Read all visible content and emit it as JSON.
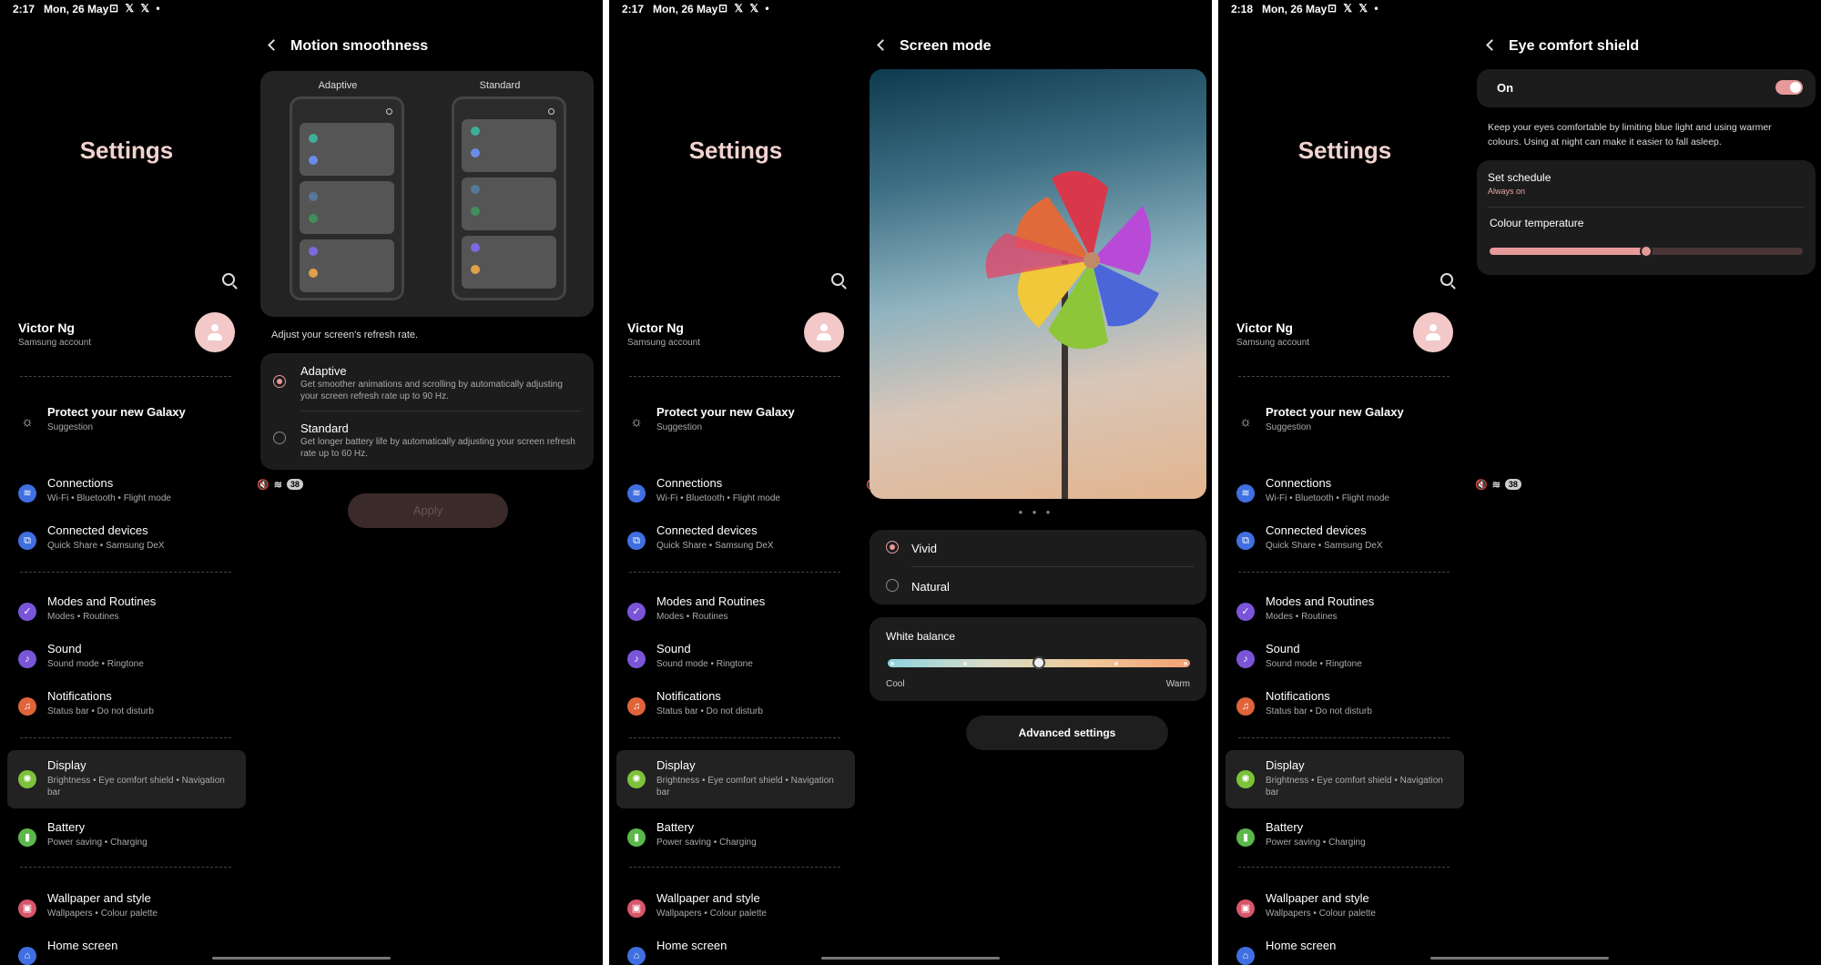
{
  "panels": [
    {
      "status": {
        "time": "2:17",
        "date": "Mon, 26 May",
        "battery": "38"
      },
      "header": "Motion smoothness",
      "preview_labels": [
        "Adaptive",
        "Standard"
      ],
      "refresh_note": "Adjust your screen's refresh rate.",
      "options": [
        {
          "title": "Adaptive",
          "desc": "Get smoother animations and scrolling by automatically adjusting your screen refresh rate up to 90 Hz.",
          "selected": true
        },
        {
          "title": "Standard",
          "desc": "Get longer battery life by automatically adjusting your screen refresh rate up to 60 Hz.",
          "selected": false
        }
      ],
      "apply_label": "Apply"
    },
    {
      "status": {
        "time": "2:17",
        "date": "Mon, 26 May",
        "battery": "38"
      },
      "header": "Screen mode",
      "modes": [
        {
          "label": "Vivid",
          "selected": true
        },
        {
          "label": "Natural",
          "selected": false
        }
      ],
      "white_balance": {
        "title": "White balance",
        "min_label": "Cool",
        "max_label": "Warm",
        "value_fraction": 0.5
      },
      "advanced_label": "Advanced settings"
    },
    {
      "status": {
        "time": "2:18",
        "date": "Mon, 26 May",
        "battery": "38"
      },
      "header": "Eye comfort shield",
      "toggle_label": "On",
      "toggle_on": true,
      "description": "Keep your eyes comfortable by limiting blue light and using warmer colours. Using at night can make it easier to fall asleep.",
      "schedule": {
        "title": "Set schedule",
        "value": "Always on"
      },
      "colour_temperature": {
        "title": "Colour temperature",
        "value_fraction": 0.5
      }
    }
  ],
  "settings": {
    "title": "Settings",
    "profile": {
      "name": "Victor Ng",
      "sub": "Samsung account"
    },
    "items": [
      {
        "title": "Protect your new Galaxy",
        "sub": "Suggestion",
        "icon": "lightbulb-icon",
        "color": "#000000"
      },
      {
        "title": "Connections",
        "sub": "Wi-Fi  •  Bluetooth  •  Flight mode",
        "icon": "wifi-icon",
        "color": "#3f6fe0"
      },
      {
        "title": "Connected devices",
        "sub": "Quick Share  •  Samsung DeX",
        "icon": "devices-icon",
        "color": "#3f6fe0"
      },
      {
        "title": "Modes and Routines",
        "sub": "Modes  •  Routines",
        "icon": "routines-icon",
        "color": "#7a55d8"
      },
      {
        "title": "Sound",
        "sub": "Sound mode  •  Ringtone",
        "icon": "sound-icon",
        "color": "#7a55d8"
      },
      {
        "title": "Notifications",
        "sub": "Status bar  •  Do not disturb",
        "icon": "bell-icon",
        "color": "#e0643a"
      },
      {
        "title": "Display",
        "sub": "Brightness  •  Eye comfort shield  •  Navigation bar",
        "icon": "sun-icon",
        "color": "#7cc23a"
      },
      {
        "title": "Battery",
        "sub": "Power saving  •  Charging",
        "icon": "battery-icon",
        "color": "#5bb84a"
      },
      {
        "title": "Wallpaper and style",
        "sub": "Wallpapers  •  Colour palette",
        "icon": "wallpaper-icon",
        "color": "#d8566a"
      },
      {
        "title": "Home screen",
        "sub": "",
        "icon": "home-icon",
        "color": "#3f6fe0"
      }
    ]
  },
  "colors": {
    "accent": "#e79a9a",
    "title": "#f2d3cf",
    "card": "#1c1c1c",
    "background": "#000000"
  }
}
